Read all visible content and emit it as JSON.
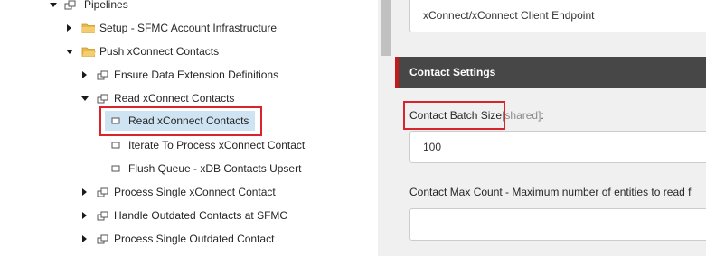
{
  "tree": {
    "items": [
      {
        "label": "Pipelines",
        "state": "expanded",
        "icon": "pipeline-icon"
      },
      {
        "label": "Setup - SFMC Account Infrastructure",
        "state": "collapsed",
        "icon": "folder-icon"
      },
      {
        "label": "Push xConnect Contacts",
        "state": "expanded",
        "icon": "folder-icon"
      },
      {
        "label": "Ensure Data Extension Definitions",
        "state": "collapsed",
        "icon": "pipeline-icon"
      },
      {
        "label": "Read xConnect Contacts",
        "state": "expanded",
        "icon": "pipeline-icon"
      },
      {
        "label": "Read xConnect Contacts",
        "state": "selected",
        "icon": "step-icon"
      },
      {
        "label": "Iterate To Process xConnect Contact",
        "state": "leaf",
        "icon": "step-icon"
      },
      {
        "label": "Flush Queue - xDB Contacts Upsert",
        "state": "leaf",
        "icon": "step-icon"
      },
      {
        "label": "Process Single xConnect Contact",
        "state": "collapsed",
        "icon": "pipeline-icon"
      },
      {
        "label": "Handle Outdated Contacts at SFMC",
        "state": "collapsed",
        "icon": "pipeline-icon"
      },
      {
        "label": "Process Single Outdated Contact",
        "state": "collapsed",
        "icon": "pipeline-icon"
      }
    ]
  },
  "details": {
    "endpoint_value": "xConnect/xConnect Client Endpoint",
    "section_title": "Contact Settings",
    "batch_size_label": "Contact Batch Size",
    "batch_size_shared": "[shared]",
    "batch_size_colon": ":",
    "batch_size_value": "100",
    "max_count_label": "Contact Max Count - Maximum number of entities to read f",
    "max_count_value": ""
  },
  "colors": {
    "highlight_border": "#d8252b",
    "selection_bg": "#cfe4f2",
    "section_bar": "#474747",
    "section_accent": "#c41a1a",
    "folder": "#e8b84a"
  }
}
